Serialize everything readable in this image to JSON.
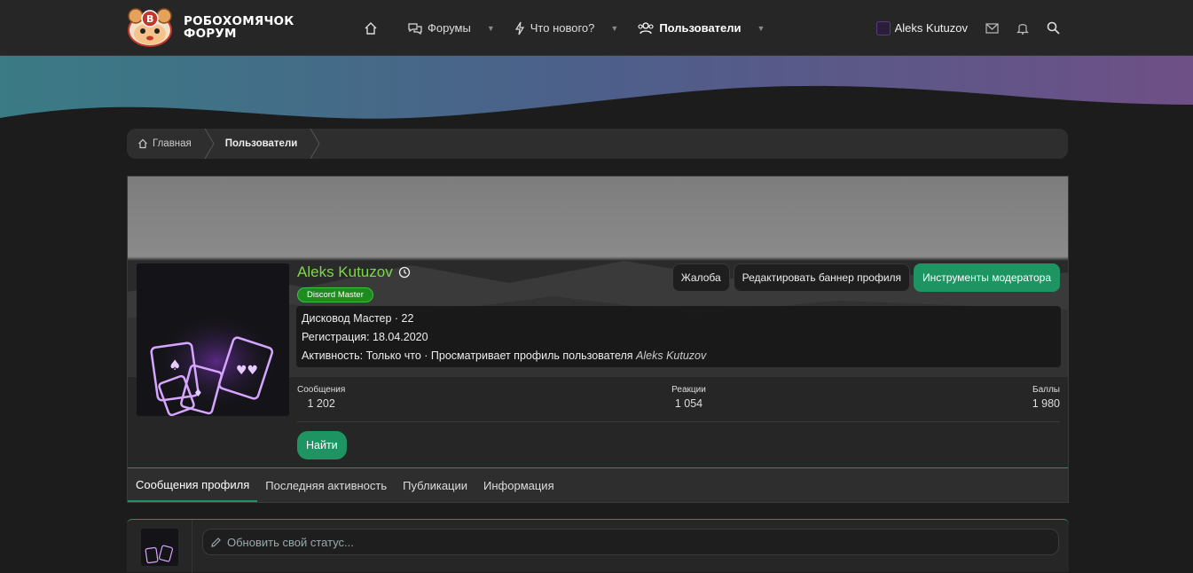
{
  "header": {
    "logo_line1": "РОБОХОМЯЧОК",
    "logo_line2": "ФОРУМ",
    "nav": [
      {
        "label": "Форумы"
      },
      {
        "label": "Что нового?"
      },
      {
        "label": "Пользователи"
      }
    ],
    "username": "Aleks Kutuzov"
  },
  "breadcrumb": {
    "home": "Главная",
    "current": "Пользователи"
  },
  "profile": {
    "name": "Aleks Kutuzov",
    "banner": "Discord Master",
    "buttons": {
      "report": "Жалоба",
      "edit_banner": "Редактировать баннер профиля",
      "mod_tools": "Инструменты модератора"
    },
    "info": {
      "title_line": "Дисковод Мастер · 22",
      "registration": "Регистрация: 18.04.2020",
      "activity_prefix": "Активность: Только что · Просматривает профиль пользователя ",
      "activity_user": "Aleks Kutuzov"
    },
    "stats": [
      {
        "label": "Сообщения",
        "value": "1 202"
      },
      {
        "label": "Реакции",
        "value": "1 054"
      },
      {
        "label": "Баллы",
        "value": "1 980"
      }
    ],
    "find_button": "Найти"
  },
  "tabs": [
    {
      "label": "Сообщения профиля"
    },
    {
      "label": "Последняя активность"
    },
    {
      "label": "Публикации"
    },
    {
      "label": "Информация"
    }
  ],
  "status": {
    "placeholder": "Обновить свой статус..."
  },
  "colors": {
    "accent": "#1f9463",
    "username": "#7cd84a",
    "banner_green": "#1f8a1f"
  }
}
